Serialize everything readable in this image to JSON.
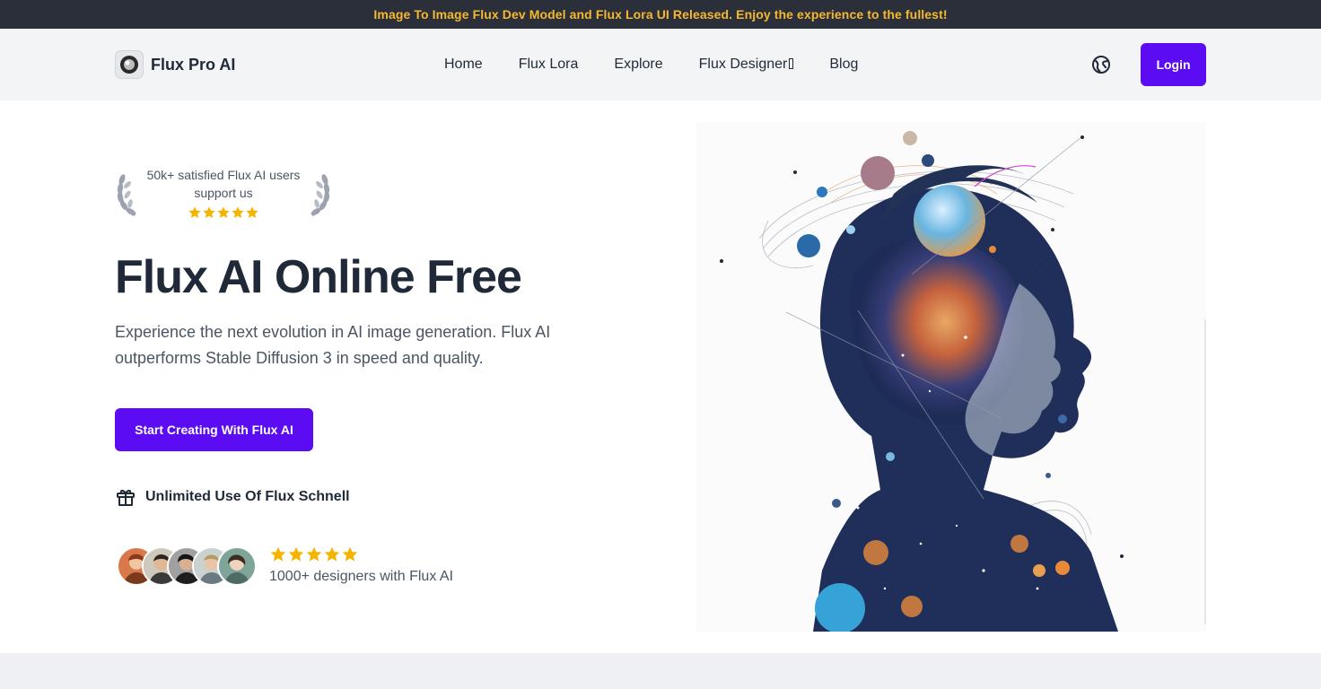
{
  "announcement": {
    "text": "Image To Image Flux Dev Model and Flux Lora UI Released. Enjoy the experience to the fullest!"
  },
  "header": {
    "brand_name": "Flux Pro AI",
    "nav": [
      {
        "label": "Home"
      },
      {
        "label": "Flux Lora"
      },
      {
        "label": "Explore"
      },
      {
        "label": "Flux Designer"
      },
      {
        "label": "Blog"
      }
    ],
    "login_label": "Login"
  },
  "hero": {
    "social_proof": "50k+ satisfied Flux AI users support us",
    "social_proof_stars": 5,
    "title": "Flux AI Online Free",
    "description": "Experience the next evolution in AI image generation. Flux AI outperforms Stable Diffusion 3 in speed and quality.",
    "cta_label": "Start Creating With Flux AI",
    "perk_text": "Unlimited Use Of Flux Schnell",
    "rating_stars": 5,
    "designers_text": "1000+ designers with Flux AI",
    "avatar_count": 5
  },
  "colors": {
    "accent": "#5b0cf2",
    "announcement_bg": "#2b2f3a",
    "announcement_text": "#f5b82e",
    "star": "#f5b400"
  },
  "icons": [
    "brand-logo-icon",
    "globe-icon",
    "laurel-left-icon",
    "laurel-right-icon",
    "star-icon",
    "gift-icon"
  ]
}
